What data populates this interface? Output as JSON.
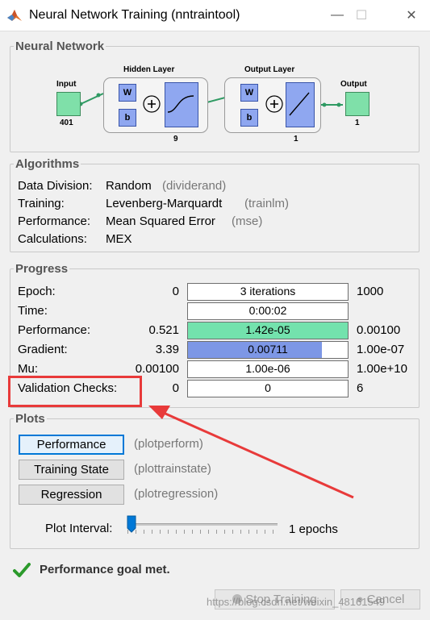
{
  "window": {
    "title": "Neural Network Training (nntraintool)"
  },
  "network": {
    "section_title": "Neural Network",
    "input_label": "Input",
    "input_size": "401",
    "hidden_label": "Hidden Layer",
    "hidden_size": "9",
    "output_layer_label": "Output Layer",
    "output_layer_size": "1",
    "output_label": "Output",
    "output_size": "1",
    "w": "W",
    "b": "b"
  },
  "algorithms": {
    "section_title": "Algorithms",
    "rows": [
      {
        "label": "Data Division:",
        "value": "Random",
        "func": "(dividerand)"
      },
      {
        "label": "Training:",
        "value": "Levenberg-Marquardt",
        "func": "(trainlm)"
      },
      {
        "label": "Performance:",
        "value": "Mean Squared Error",
        "func": "(mse)"
      },
      {
        "label": "Calculations:",
        "value": "MEX",
        "func": ""
      }
    ]
  },
  "progress": {
    "section_title": "Progress",
    "rows": [
      {
        "label": "Epoch:",
        "start": "0",
        "current": "3 iterations",
        "end": "1000",
        "fill": 0.0,
        "color": "#ffffff"
      },
      {
        "label": "Time:",
        "start": "",
        "current": "0:00:02",
        "end": "",
        "fill": 0.0,
        "color": "#ffffff"
      },
      {
        "label": "Performance:",
        "start": "0.521",
        "current": "1.42e-05",
        "end": "0.00100",
        "fill": 1.0,
        "color": "#73e2ad"
      },
      {
        "label": "Gradient:",
        "start": "3.39",
        "current": "0.00711",
        "end": "1.00e-07",
        "fill": 0.84,
        "color": "#7d97e6"
      },
      {
        "label": "Mu:",
        "start": "0.00100",
        "current": "1.00e-06",
        "end": "1.00e+10",
        "fill": 0.0,
        "color": "#ffffff"
      },
      {
        "label": "Validation Checks:",
        "start": "0",
        "current": "0",
        "end": "6",
        "fill": 0.0,
        "color": "#ffffff"
      }
    ]
  },
  "plots": {
    "section_title": "Plots",
    "buttons": [
      {
        "label": "Performance",
        "func": "(plotperform)"
      },
      {
        "label": "Training State",
        "func": "(plottrainstate)"
      },
      {
        "label": "Regression",
        "func": "(plotregression)"
      }
    ],
    "interval_label": "Plot Interval:",
    "interval_value": "1 epochs"
  },
  "status": {
    "message": "Performance goal met."
  },
  "actions": {
    "stop_label": "Stop Training",
    "cancel_label": "Cancel"
  },
  "watermark": "https://blog.csdn.net/weixin_48161549",
  "colors": {
    "annotation": "#e83a3a",
    "green": "#73e2ad",
    "blue": "#7d97e6",
    "focus": "#0078d7"
  }
}
